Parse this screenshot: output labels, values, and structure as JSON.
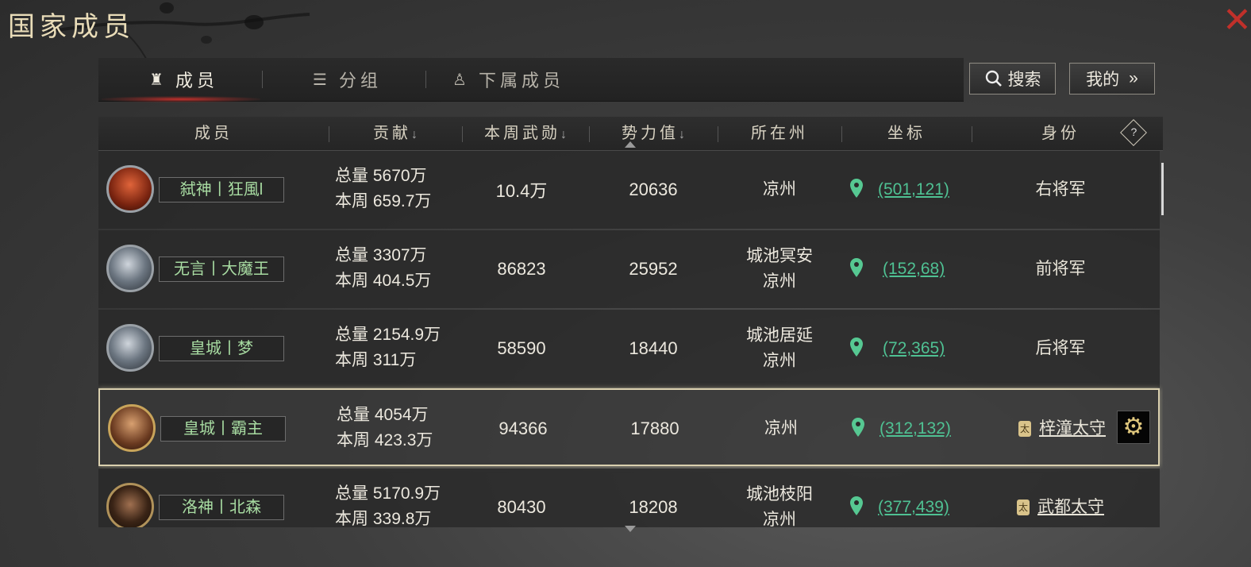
{
  "window": {
    "title": "国家成员",
    "close_icon": "✕"
  },
  "tabs": [
    {
      "label": "成员",
      "icon": "member-icon",
      "active": true
    },
    {
      "label": "分组",
      "icon": "list-icon",
      "active": false
    },
    {
      "label": "下属成员",
      "icon": "hierarchy-icon",
      "active": false
    }
  ],
  "actions": {
    "search_label": "搜索",
    "mine_label": "我的",
    "mine_arrow": "»"
  },
  "columns": {
    "member": "成员",
    "contribution": "贡献",
    "weekly_merit": "本周武勋",
    "power": "势力值",
    "state": "所在州",
    "coords": "坐标",
    "rank": "身份",
    "sort_arrow": "↓",
    "help": "?"
  },
  "rows": [
    {
      "name": "弑神丨狂風l",
      "total": "总量 5670万",
      "week": "本周 659.7万",
      "merit": "10.4万",
      "power": "20636",
      "state_line1": "凉州",
      "state_line2": "",
      "coords": "(501,121)",
      "rank": "右将军",
      "rank_badge": ""
    },
    {
      "name": "无言丨大魔王",
      "total": "总量 3307万",
      "week": "本周 404.5万",
      "merit": "86823",
      "power": "25952",
      "state_line1": "城池冥安",
      "state_line2": "凉州",
      "coords": "(152,68)",
      "rank": "前将军",
      "rank_badge": ""
    },
    {
      "name": "皇城丨梦",
      "total": "总量 2154.9万",
      "week": "本周 311万",
      "merit": "58590",
      "power": "18440",
      "state_line1": "城池居延",
      "state_line2": "凉州",
      "coords": "(72,365)",
      "rank": "后将军",
      "rank_badge": ""
    },
    {
      "name": "皇城丨霸主",
      "total": "总量 4054万",
      "week": "本周 423.3万",
      "merit": "94366",
      "power": "17880",
      "state_line1": "凉州",
      "state_line2": "",
      "coords": "(312,132)",
      "rank": "梓潼太守",
      "rank_badge": "太"
    },
    {
      "name": "洛神丨北森",
      "total": "总量 5170.9万",
      "week": "本周 339.8万",
      "merit": "80430",
      "power": "18208",
      "state_line1": "城池枝阳",
      "state_line2": "凉州",
      "coords": "(377,439)",
      "rank": "武都太守",
      "rank_badge": "太"
    }
  ],
  "selected_row_gear": "⚙"
}
